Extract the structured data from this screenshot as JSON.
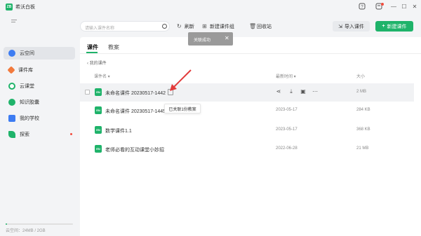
{
  "app": {
    "logo_text": "ZB",
    "title": "希沃白板"
  },
  "window": {
    "help_icon": "help-icon",
    "notify_icon": "notification-icon",
    "minimize": "—",
    "maximize": "☐",
    "close": "✕"
  },
  "sidebar": {
    "items": [
      {
        "label": "云空间",
        "icon": "cloud-icon",
        "color": "#3d7cf2"
      },
      {
        "label": "课件库",
        "icon": "gem-icon",
        "color": "#f27a3d"
      },
      {
        "label": "云课堂",
        "icon": "play-circle-icon",
        "color": "#1fb36a"
      },
      {
        "label": "知识胶囊",
        "icon": "capsule-icon",
        "color": "#1fb36a"
      },
      {
        "label": "我的学校",
        "icon": "school-icon",
        "color": "#3d7cf2"
      },
      {
        "label": "探索",
        "icon": "rocket-icon",
        "color": "#1fb36a"
      }
    ],
    "storage_label": "云空间：24MB / 2GB",
    "storage_fraction": 0.012
  },
  "toolbar": {
    "search_placeholder": "请输入课件名称",
    "refresh": "刷新",
    "new_group": "新建课件组",
    "recycle": "回收站",
    "import": "导入课件",
    "new": "新建课件"
  },
  "toast": {
    "text": "关联成功",
    "close": "✕"
  },
  "tabs": [
    {
      "label": "课件",
      "active": true
    },
    {
      "label": "教案",
      "active": false
    }
  ],
  "breadcrumb": "我的课件",
  "table": {
    "headers": {
      "name": "课件名 ▾",
      "modified": "最新时间 ▾",
      "size": "大小"
    },
    "rows": [
      {
        "name": "未命名课件 20230517-1442",
        "date": "",
        "size": "2 MB"
      },
      {
        "name": "未命名课件 20230517-1445",
        "date": "2023-05-17",
        "size": "284 KB"
      },
      {
        "name": "数学课件1.1",
        "date": "2023-05-17",
        "size": "368 KB"
      },
      {
        "name": "老师必看的互动课堂小妙招",
        "date": "2022-06-28",
        "size": "21 MB"
      }
    ]
  },
  "tooltip": "已关联1份教案",
  "colors": {
    "accent": "#1fb36a",
    "arrow": "#e23b3b"
  }
}
